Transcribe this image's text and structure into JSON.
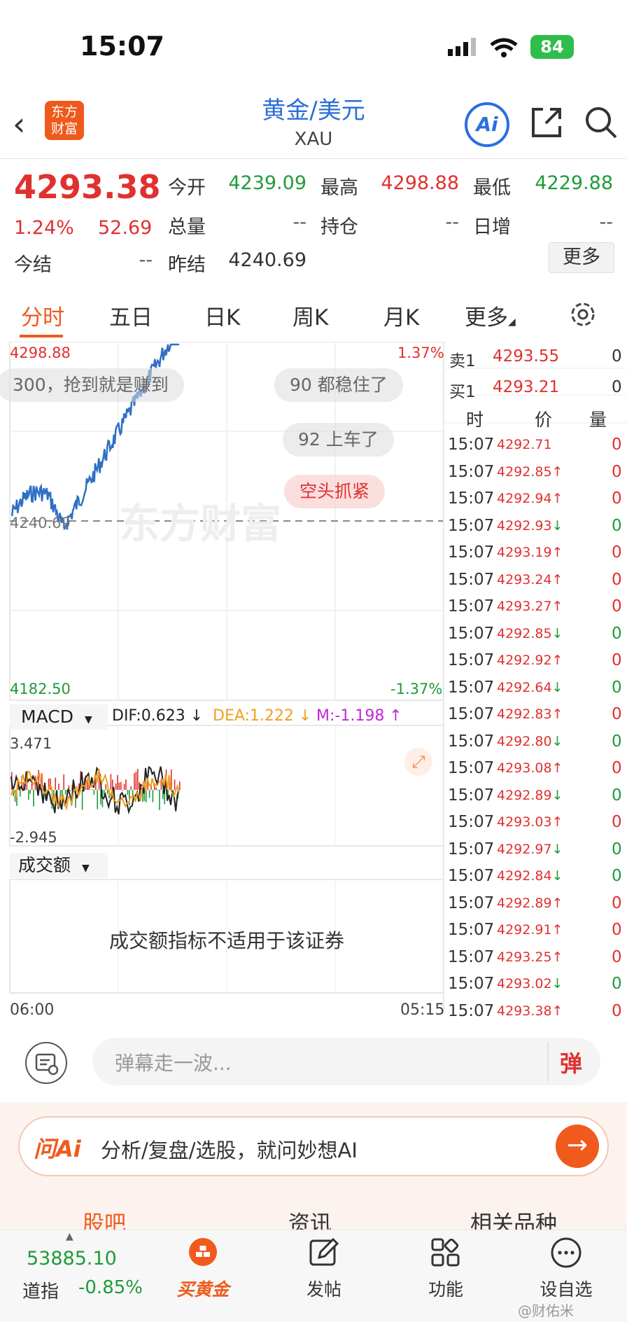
{
  "status_bar": {
    "time": "15:07",
    "battery": "84"
  },
  "header": {
    "logo_text": "东方财富",
    "title": "黄金/美元",
    "subtitle": "XAU",
    "ai_label": "Ai"
  },
  "quote": {
    "price": "4293.38",
    "change_pct": "1.24%",
    "change": "52.69",
    "fields": [
      {
        "label": "今开",
        "value": "4239.09",
        "color": "green"
      },
      {
        "label": "最高",
        "value": "4298.88",
        "color": "red"
      },
      {
        "label": "最低",
        "value": "4229.88",
        "color": "green"
      },
      {
        "label": "总量",
        "value": "--",
        "color": "gray"
      },
      {
        "label": "持仓",
        "value": "--",
        "color": "gray"
      },
      {
        "label": "日增",
        "value": "--",
        "color": "gray"
      },
      {
        "label": "今结",
        "value": "--",
        "color": "gray"
      },
      {
        "label": "昨结",
        "value": "4240.69",
        "color": "gray"
      }
    ],
    "more_label": "更多"
  },
  "tabs": [
    "分时",
    "五日",
    "日K",
    "周K",
    "月K",
    "更多"
  ],
  "chart": {
    "y_max": "4298.88",
    "y_min": "4182.50",
    "pct_max": "1.37%",
    "pct_min": "-1.37%",
    "prev_close_label": "4240.69",
    "x_start": "06:00",
    "x_end": "05:15",
    "macd_selector": "MACD",
    "macd_dif": "DIF:0.623 ↓",
    "macd_dea": "DEA:1.222 ↓",
    "macd_m": "M:-1.198 ↑",
    "macd_max": "3.471",
    "macd_min": "-2.945",
    "volume_selector": "成交额",
    "volume_notice": "成交额指标不适用于该证券",
    "watermark": "东方财富"
  },
  "danmaku": [
    "300，抢到就是赚到",
    "90 都稳住了",
    "92 上车了",
    "空头抓紧"
  ],
  "order_book": {
    "sell1_label": "卖1",
    "sell1_price": "4293.55",
    "sell1_vol": "0",
    "buy1_label": "买1",
    "buy1_price": "4293.21",
    "buy1_vol": "0",
    "col_time": "时",
    "col_price": "价",
    "col_vol": "量"
  },
  "ticks": [
    {
      "time": "15:07",
      "price": "4292.71",
      "arrow": "",
      "vol": "0",
      "vol_color": "red"
    },
    {
      "time": "15:07",
      "price": "4292.85",
      "arrow": "↑",
      "vol": "0",
      "vol_color": "red"
    },
    {
      "time": "15:07",
      "price": "4292.94",
      "arrow": "↑",
      "vol": "0",
      "vol_color": "red"
    },
    {
      "time": "15:07",
      "price": "4292.93",
      "arrow": "↓",
      "vol": "0",
      "vol_color": "green"
    },
    {
      "time": "15:07",
      "price": "4293.19",
      "arrow": "↑",
      "vol": "0",
      "vol_color": "red"
    },
    {
      "time": "15:07",
      "price": "4293.24",
      "arrow": "↑",
      "vol": "0",
      "vol_color": "red"
    },
    {
      "time": "15:07",
      "price": "4293.27",
      "arrow": "↑",
      "vol": "0",
      "vol_color": "red"
    },
    {
      "time": "15:07",
      "price": "4292.85",
      "arrow": "↓",
      "vol": "0",
      "vol_color": "green"
    },
    {
      "time": "15:07",
      "price": "4292.92",
      "arrow": "↑",
      "vol": "0",
      "vol_color": "red"
    },
    {
      "time": "15:07",
      "price": "4292.64",
      "arrow": "↓",
      "vol": "0",
      "vol_color": "green"
    },
    {
      "time": "15:07",
      "price": "4292.83",
      "arrow": "↑",
      "vol": "0",
      "vol_color": "red"
    },
    {
      "time": "15:07",
      "price": "4292.80",
      "arrow": "↓",
      "vol": "0",
      "vol_color": "green"
    },
    {
      "time": "15:07",
      "price": "4293.08",
      "arrow": "↑",
      "vol": "0",
      "vol_color": "red"
    },
    {
      "time": "15:07",
      "price": "4292.89",
      "arrow": "↓",
      "vol": "0",
      "vol_color": "green"
    },
    {
      "time": "15:07",
      "price": "4293.03",
      "arrow": "↑",
      "vol": "0",
      "vol_color": "red"
    },
    {
      "time": "15:07",
      "price": "4292.97",
      "arrow": "↓",
      "vol": "0",
      "vol_color": "green"
    },
    {
      "time": "15:07",
      "price": "4292.84",
      "arrow": "↓",
      "vol": "0",
      "vol_color": "green"
    },
    {
      "time": "15:07",
      "price": "4292.89",
      "arrow": "↑",
      "vol": "0",
      "vol_color": "red"
    },
    {
      "time": "15:07",
      "price": "4292.91",
      "arrow": "↑",
      "vol": "0",
      "vol_color": "red"
    },
    {
      "time": "15:07",
      "price": "4293.25",
      "arrow": "↑",
      "vol": "0",
      "vol_color": "red"
    },
    {
      "time": "15:07",
      "price": "4293.02",
      "arrow": "↓",
      "vol": "0",
      "vol_color": "green"
    },
    {
      "time": "15:07",
      "price": "4293.38",
      "arrow": "↑",
      "vol": "0",
      "vol_color": "red"
    }
  ],
  "danmaku_input": {
    "placeholder": "弹幕走一波...",
    "send_label": "弹"
  },
  "ai_bar": {
    "brand": "问Ai",
    "text": "分析/复盘/选股，就问妙想AI",
    "go": "→"
  },
  "section_tabs": [
    "股吧",
    "资讯",
    "相关品种"
  ],
  "bottom_nav": {
    "index_value": "53885.10",
    "index_name": "道指",
    "index_change": "-0.85%",
    "items": [
      "买黄金",
      "发帖",
      "功能",
      "设自选"
    ]
  },
  "watermark_credit": "@财佑米",
  "colors": {
    "up": "#e0312f",
    "down": "#1f9b3a",
    "accent": "#ef5a1c",
    "link": "#2b6fd6",
    "line": "#2f6fc4"
  }
}
